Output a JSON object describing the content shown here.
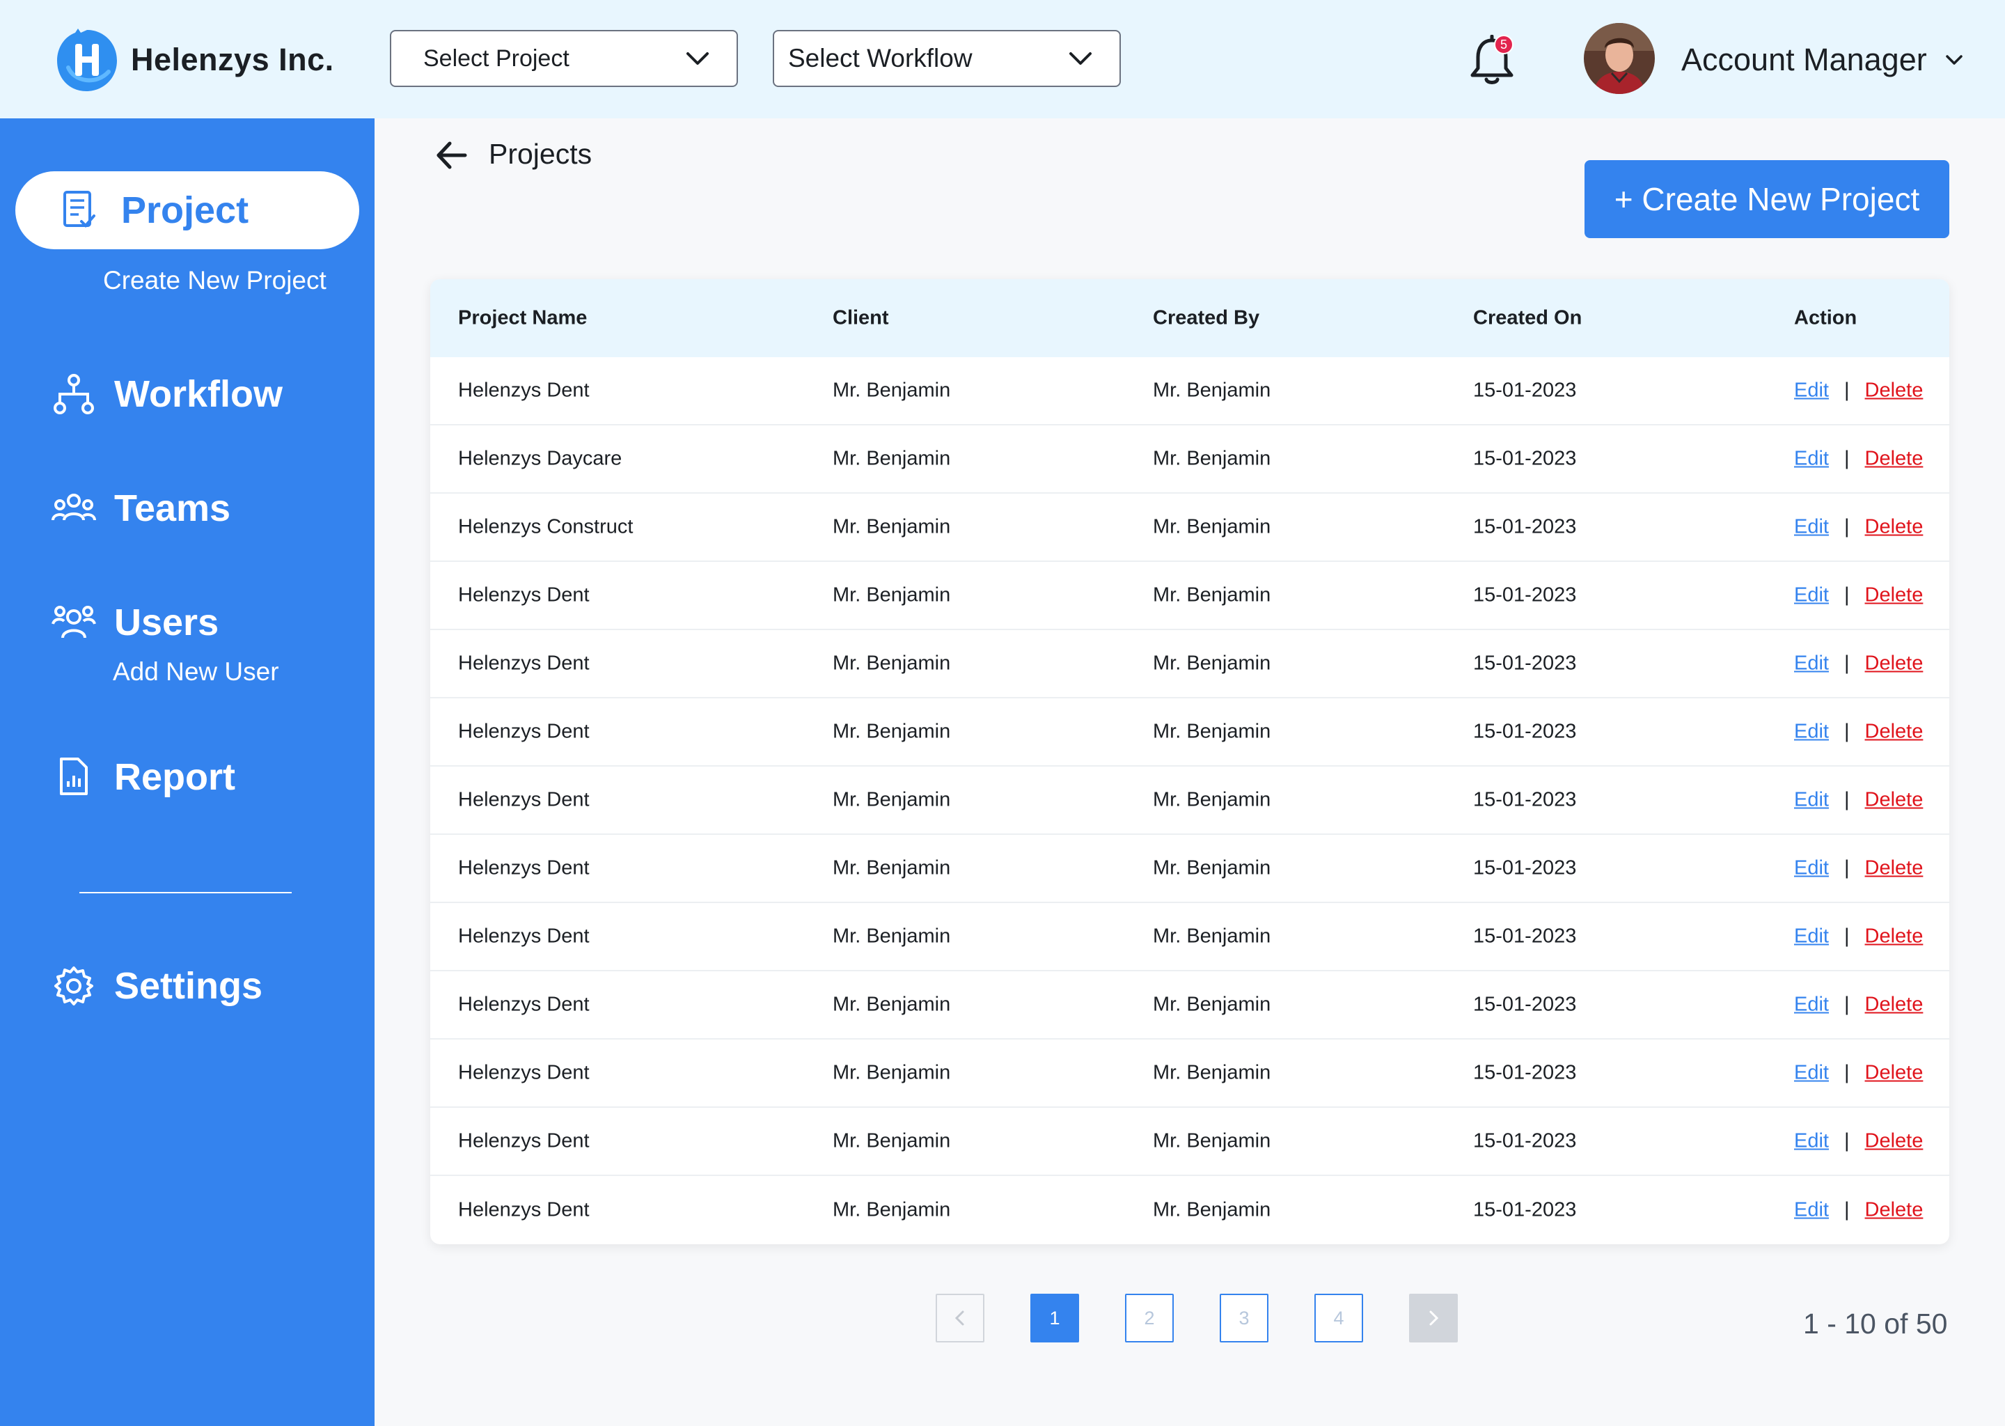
{
  "brand": {
    "name": "Helenzys Inc.",
    "logo_letter": "H"
  },
  "header": {
    "project_select": "Select Project",
    "workflow_select": "Select Workflow",
    "notification_count": "5",
    "account_label": "Account Manager"
  },
  "sidebar": {
    "items": [
      {
        "label": "Project",
        "sub": "Create New Project"
      },
      {
        "label": "Workflow"
      },
      {
        "label": "Teams"
      },
      {
        "label": "Users",
        "sub": "Add New User"
      },
      {
        "label": "Report"
      },
      {
        "label": "Settings"
      }
    ]
  },
  "main": {
    "title": "Projects",
    "create_button": "+ Create New Project",
    "columns": [
      "Project Name",
      "Client",
      "Created By",
      "Created On",
      "Action"
    ],
    "edit_label": "Edit",
    "separator": "|",
    "delete_label": "Delete",
    "rows": [
      [
        "Helenzys Dent",
        "Mr. Benjamin",
        "Mr. Benjamin",
        "15-01-2023"
      ],
      [
        "Helenzys Daycare",
        "Mr. Benjamin",
        "Mr. Benjamin",
        "15-01-2023"
      ],
      [
        "Helenzys Construct",
        "Mr. Benjamin",
        "Mr. Benjamin",
        "15-01-2023"
      ],
      [
        "Helenzys Dent",
        "Mr. Benjamin",
        "Mr. Benjamin",
        "15-01-2023"
      ],
      [
        "Helenzys Dent",
        "Mr. Benjamin",
        "Mr. Benjamin",
        "15-01-2023"
      ],
      [
        "Helenzys Dent",
        "Mr. Benjamin",
        "Mr. Benjamin",
        "15-01-2023"
      ],
      [
        "Helenzys Dent",
        "Mr. Benjamin",
        "Mr. Benjamin",
        "15-01-2023"
      ],
      [
        "Helenzys Dent",
        "Mr. Benjamin",
        "Mr. Benjamin",
        "15-01-2023"
      ],
      [
        "Helenzys Dent",
        "Mr. Benjamin",
        "Mr. Benjamin",
        "15-01-2023"
      ],
      [
        "Helenzys Dent",
        "Mr. Benjamin",
        "Mr. Benjamin",
        "15-01-2023"
      ],
      [
        "Helenzys Dent",
        "Mr. Benjamin",
        "Mr. Benjamin",
        "15-01-2023"
      ],
      [
        "Helenzys Dent",
        "Mr. Benjamin",
        "Mr. Benjamin",
        "15-01-2023"
      ],
      [
        "Helenzys Dent",
        "Mr. Benjamin",
        "Mr. Benjamin",
        "15-01-2023"
      ]
    ]
  },
  "pagination": {
    "pages": [
      "1",
      "2",
      "3",
      "4"
    ],
    "current": "1",
    "summary": "1 - 10 of 50"
  },
  "colors": {
    "accent": "#3483ee",
    "header_bg": "#e8f6fe",
    "delete": "#e0131b",
    "badge": "#e2244e"
  }
}
